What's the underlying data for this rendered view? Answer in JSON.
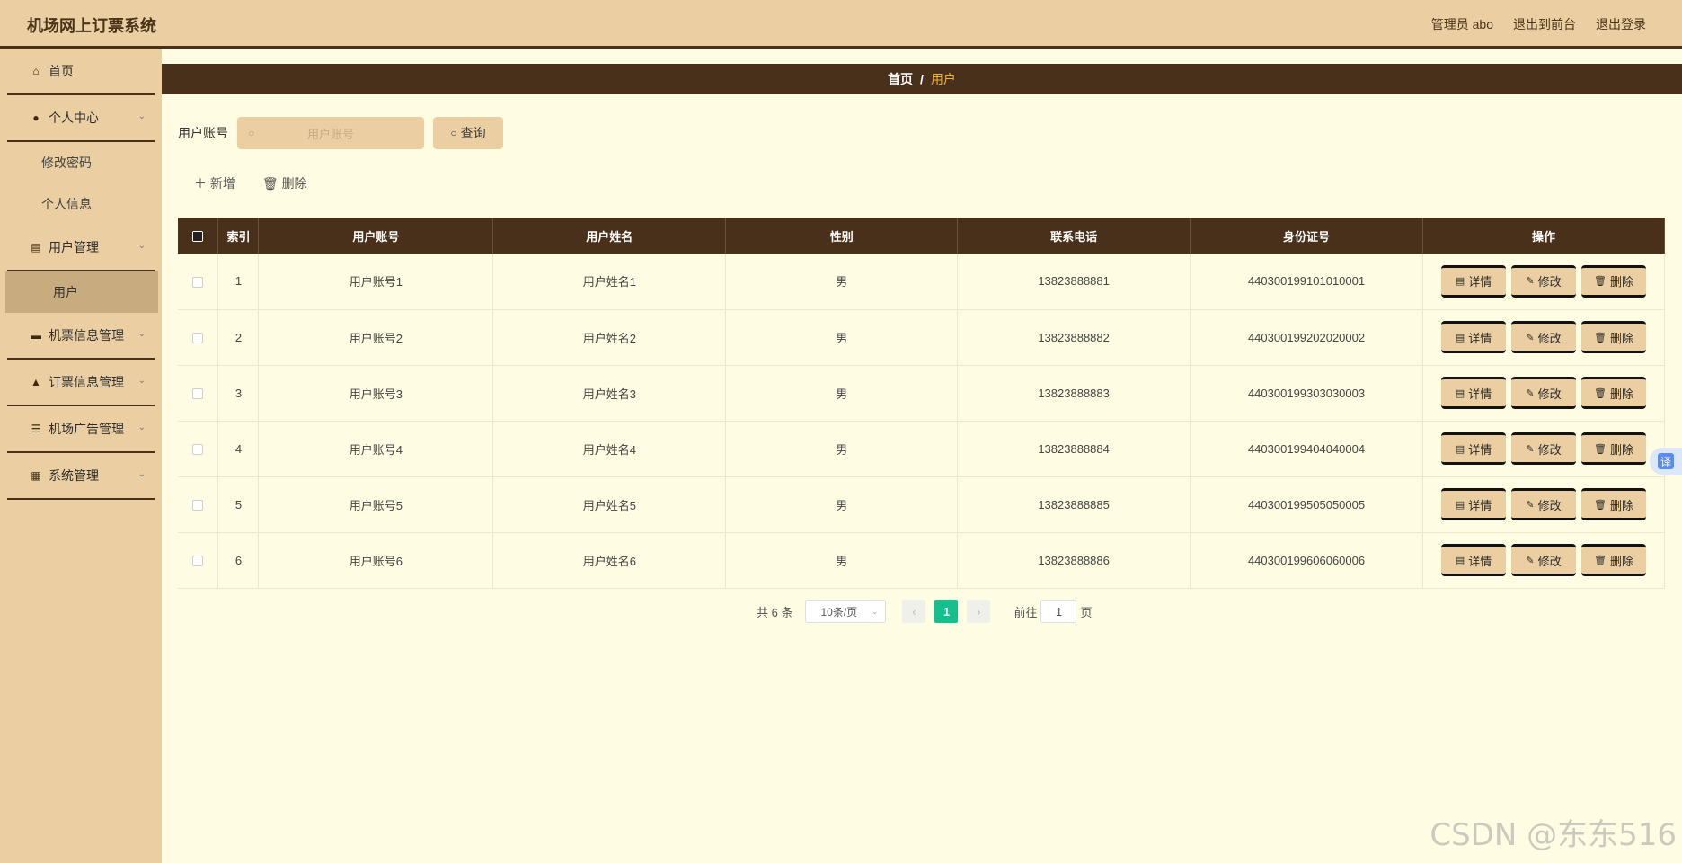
{
  "header": {
    "title": "机场网上订票系统",
    "admin_label": "管理员 abo",
    "back_to_front": "退出到前台",
    "logout": "退出登录"
  },
  "sidebar": {
    "home": "首页",
    "personal_center": "个人中心",
    "change_password": "修改密码",
    "personal_info": "个人信息",
    "user_management": "用户管理",
    "user": "用户",
    "ticket_info_management": "机票信息管理",
    "booking_info_management": "订票信息管理",
    "airport_ad_management": "机场广告管理",
    "system_management": "系统管理"
  },
  "breadcrumb": {
    "home": "首页",
    "separator": "/",
    "current": "用户"
  },
  "search": {
    "label": "用户账号",
    "placeholder": "用户账号",
    "button": "查询"
  },
  "actions": {
    "add": "新增",
    "delete": "删除"
  },
  "table": {
    "headers": [
      "索引",
      "用户账号",
      "用户姓名",
      "性别",
      "联系电话",
      "身份证号",
      "操作"
    ],
    "rows": [
      [
        "1",
        "用户账号1",
        "用户姓名1",
        "男",
        "13823888881",
        "440300199101010001"
      ],
      [
        "2",
        "用户账号2",
        "用户姓名2",
        "男",
        "13823888882",
        "440300199202020002"
      ],
      [
        "3",
        "用户账号3",
        "用户姓名3",
        "男",
        "13823888883",
        "440300199303030003"
      ],
      [
        "4",
        "用户账号4",
        "用户姓名4",
        "男",
        "13823888884",
        "440300199404040004"
      ],
      [
        "5",
        "用户账号5",
        "用户姓名5",
        "男",
        "13823888885",
        "440300199505050005"
      ],
      [
        "6",
        "用户账号6",
        "用户姓名6",
        "男",
        "13823888886",
        "440300199606060006"
      ]
    ],
    "op_detail": "详情",
    "op_edit": "修改",
    "op_delete": "删除"
  },
  "pagination": {
    "total": "共 6 条",
    "page_size": "10条/页",
    "current_page": "1",
    "goto_prefix": "前往",
    "goto_value": "1",
    "goto_suffix": "页"
  },
  "translate_badge": "译",
  "watermark": "CSDN @东东516",
  "colors": {
    "header_bg": "#ebcfa3",
    "dark_brown": "#48301a",
    "main_bg": "#fefde3",
    "active_page": "#13c18f",
    "breadcrumb_current": "#f0b429"
  }
}
